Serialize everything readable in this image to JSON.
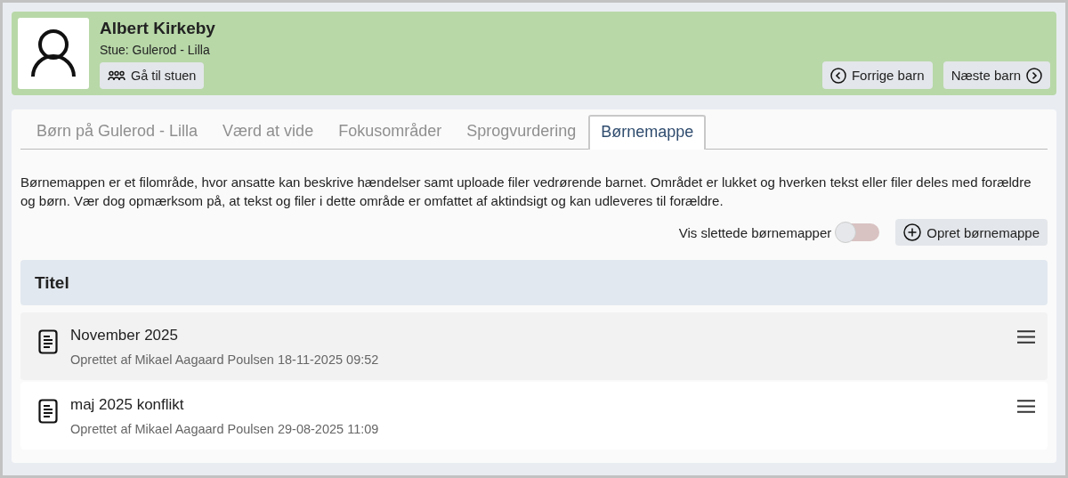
{
  "child": {
    "name": "Albert Kirkeby",
    "room": "Stue: Gulerod - Lilla",
    "room_button": "Gå til stuen"
  },
  "nav": {
    "previous": "Forrige barn",
    "next": "Næste barn"
  },
  "tabs": [
    {
      "label": "Børn på Gulerod - Lilla",
      "selected": false
    },
    {
      "label": "Værd at vide",
      "selected": false
    },
    {
      "label": "Fokusområder",
      "selected": false
    },
    {
      "label": "Sprogvurdering",
      "selected": false
    },
    {
      "label": "Børnemappe",
      "selected": true
    }
  ],
  "description": "Børnemappen er et filområde, hvor ansatte kan beskrive hændelser samt uploade filer vedrørende barnet. Området er lukket og hverken tekst eller filer deles med forældre og børn. Vær dog opmærksom på, at tekst og filer i dette område er omfattet af aktindsigt og kan udleveres til forældre.",
  "show_deleted": {
    "label": "Vis slettede børnemapper",
    "on": false
  },
  "create_button": "Opret børnemappe",
  "table": {
    "columns": [
      "Titel"
    ],
    "rows": [
      {
        "title": "November 2025",
        "meta": "Oprettet af Mikael Aagaard Poulsen 18-11-2025 09:52",
        "selected": true
      },
      {
        "title": "maj 2025 konflikt",
        "meta": "Oprettet af Mikael Aagaard Poulsen 29-08-2025 11:09",
        "selected": false
      }
    ]
  }
}
